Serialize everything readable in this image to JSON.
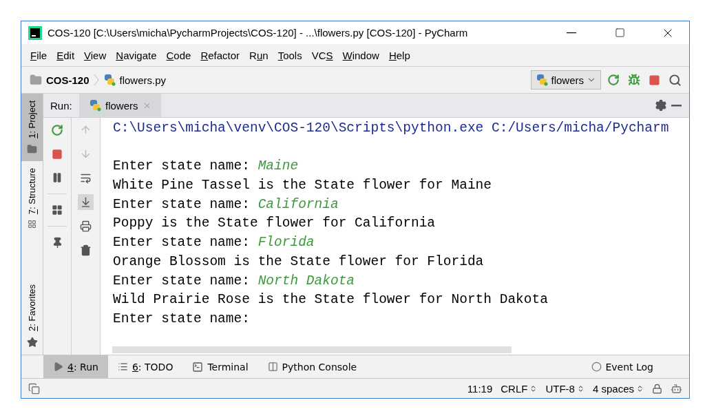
{
  "window": {
    "title": "COS-120 [C:\\Users\\micha\\PycharmProjects\\COS-120] - ...\\flowers.py [COS-120] - PyCharm"
  },
  "menu": [
    {
      "key": "F",
      "post": "ile"
    },
    {
      "key": "E",
      "post": "dit"
    },
    {
      "key": "V",
      "post": "iew"
    },
    {
      "key": "N",
      "post": "avigate"
    },
    {
      "key": "C",
      "post": "ode"
    },
    {
      "key": "R",
      "post": "efactor"
    },
    {
      "pre": "R",
      "key": "u",
      "post": "n"
    },
    {
      "key": "T",
      "post": "ools"
    },
    {
      "pre": "VC",
      "key": "S"
    },
    {
      "key": "W",
      "post": "indow"
    },
    {
      "key": "H",
      "post": "elp"
    }
  ],
  "breadcrumb": {
    "project": "COS-120",
    "file": "flowers.py"
  },
  "run_config": {
    "label": "flowers"
  },
  "side_tabs": [
    {
      "key": "1",
      "post": ": Project",
      "selected": true
    },
    {
      "key": "7",
      "post": ": Structure",
      "selected": false
    },
    {
      "key": "2",
      "post": ": Favorites",
      "selected": false
    }
  ],
  "run_panel": {
    "label": "Run:",
    "tab": "flowers"
  },
  "console": [
    {
      "kind": "command",
      "text": "C:\\Users\\micha\\venv\\COS-120\\Scripts\\python.exe C:/Users/micha/Pycharm"
    },
    {
      "kind": "blank"
    },
    {
      "kind": "prompt",
      "text": "Enter state name: ",
      "input": "Maine"
    },
    {
      "kind": "output",
      "text": "White Pine Tassel is the State flower for Maine"
    },
    {
      "kind": "prompt",
      "text": "Enter state name: ",
      "input": "California"
    },
    {
      "kind": "output",
      "text": "Poppy is the State flower for California"
    },
    {
      "kind": "prompt",
      "text": "Enter state name: ",
      "input": "Florida"
    },
    {
      "kind": "output",
      "text": "Orange Blossom is the State flower for Florida"
    },
    {
      "kind": "prompt",
      "text": "Enter state name: ",
      "input": "North Dakota"
    },
    {
      "kind": "output",
      "text": "Wild Prairie Rose is the State flower for North Dakota"
    },
    {
      "kind": "prompt",
      "text": "Enter state name: "
    }
  ],
  "bottom_tabs": [
    {
      "key": "4",
      "post": ": Run",
      "selected": true
    },
    {
      "key": "6",
      "post": ": TODO",
      "selected": false
    },
    {
      "post": "Terminal",
      "selected": false
    },
    {
      "post": "Python Console",
      "selected": false
    }
  ],
  "event_log": "Event Log",
  "status_bar": {
    "position": "11:19",
    "line_separator": "CRLF",
    "encoding": "UTF-8",
    "indent": "4 spaces"
  }
}
